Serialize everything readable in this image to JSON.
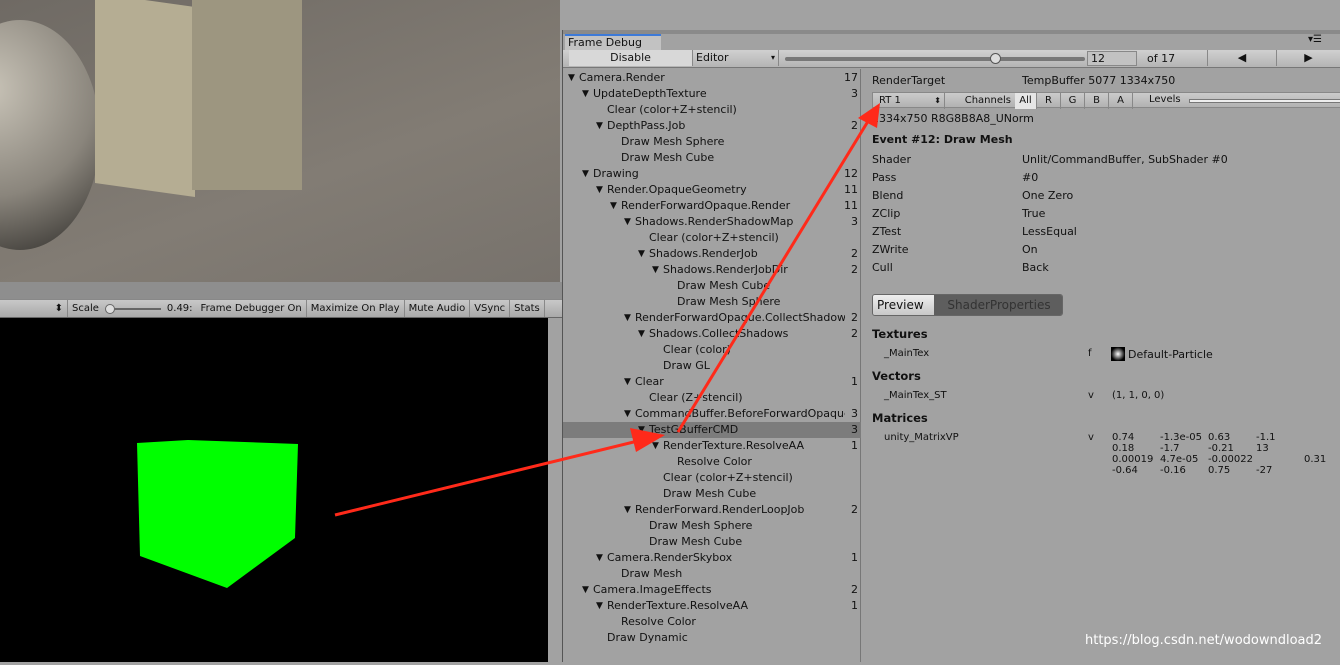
{
  "game_toolbar": {
    "scale_label": "Scale",
    "scale_value": "0.49:",
    "items": [
      "Frame Debugger On",
      "Maximize On Play",
      "Mute Audio",
      "VSync",
      "Stats"
    ]
  },
  "frame_debug": {
    "tab": "Frame Debug",
    "disable": "Disable",
    "target": "Editor",
    "event_index": "12",
    "event_total": "of 17",
    "event_fraction": 0.7,
    "tree": [
      {
        "l": 0,
        "t": "Camera.Render",
        "c": "17",
        "e": true
      },
      {
        "l": 1,
        "t": "UpdateDepthTexture",
        "c": "3",
        "e": true
      },
      {
        "l": 2,
        "t": "Clear (color+Z+stencil)"
      },
      {
        "l": 2,
        "t": "DepthPass.Job",
        "c": "2",
        "e": true
      },
      {
        "l": 3,
        "t": "Draw Mesh Sphere"
      },
      {
        "l": 3,
        "t": "Draw Mesh Cube"
      },
      {
        "l": 1,
        "t": "Drawing",
        "c": "12",
        "e": true
      },
      {
        "l": 2,
        "t": "Render.OpaqueGeometry",
        "c": "11",
        "e": true
      },
      {
        "l": 3,
        "t": "RenderForwardOpaque.Render",
        "c": "11",
        "e": true
      },
      {
        "l": 4,
        "t": "Shadows.RenderShadowMap",
        "c": "3",
        "e": true
      },
      {
        "l": 5,
        "t": "Clear (color+Z+stencil)"
      },
      {
        "l": 5,
        "t": "Shadows.RenderJob",
        "c": "2",
        "e": true
      },
      {
        "l": 6,
        "t": "Shadows.RenderJobDir",
        "c": "2",
        "e": true
      },
      {
        "l": 7,
        "t": "Draw Mesh Cube"
      },
      {
        "l": 7,
        "t": "Draw Mesh Sphere"
      },
      {
        "l": 4,
        "t": "RenderForwardOpaque.CollectShadows",
        "c": "2",
        "e": true
      },
      {
        "l": 5,
        "t": "Shadows.CollectShadows",
        "c": "2",
        "e": true
      },
      {
        "l": 6,
        "t": "Clear (color)"
      },
      {
        "l": 6,
        "t": "Draw GL"
      },
      {
        "l": 4,
        "t": "Clear",
        "c": "1",
        "e": true
      },
      {
        "l": 5,
        "t": "Clear (Z+stencil)"
      },
      {
        "l": 4,
        "t": "CommandBuffer.BeforeForwardOpaque",
        "c": "3",
        "e": true
      },
      {
        "l": 5,
        "t": "TestGBufferCMD",
        "c": "3",
        "e": true,
        "sel": true
      },
      {
        "l": 6,
        "t": "RenderTexture.ResolveAA",
        "c": "1",
        "e": true
      },
      {
        "l": 7,
        "t": "Resolve Color"
      },
      {
        "l": 6,
        "t": "Clear (color+Z+stencil)"
      },
      {
        "l": 6,
        "t": "Draw Mesh Cube"
      },
      {
        "l": 4,
        "t": "RenderForward.RenderLoopJob",
        "c": "2",
        "e": true
      },
      {
        "l": 5,
        "t": "Draw Mesh Sphere"
      },
      {
        "l": 5,
        "t": "Draw Mesh Cube"
      },
      {
        "l": 2,
        "t": "Camera.RenderSkybox",
        "c": "1",
        "e": true
      },
      {
        "l": 3,
        "t": "Draw Mesh"
      },
      {
        "l": 1,
        "t": "Camera.ImageEffects",
        "c": "2",
        "e": true
      },
      {
        "l": 2,
        "t": "RenderTexture.ResolveAA",
        "c": "1",
        "e": true
      },
      {
        "l": 3,
        "t": "Resolve Color"
      },
      {
        "l": 2,
        "t": "Draw Dynamic"
      }
    ],
    "detail": {
      "rt_label": "RenderTarget",
      "rt_value": "TempBuffer 5077 1334x750",
      "rt_select": "RT 1",
      "channels": "Channels",
      "channel_buttons": [
        "All",
        "R",
        "G",
        "B",
        "A"
      ],
      "levels": "Levels",
      "format": "1334x750 R8G8B8A8_UNorm",
      "event_title": "Event #12: Draw Mesh",
      "props": [
        [
          "Shader",
          "Unlit/CommandBuffer, SubShader #0"
        ],
        [
          "Pass",
          "#0"
        ],
        [
          "Blend",
          "One Zero"
        ],
        [
          "ZClip",
          "True"
        ],
        [
          "ZTest",
          "LessEqual"
        ],
        [
          "ZWrite",
          "On"
        ],
        [
          "Cull",
          "Back"
        ]
      ],
      "tabs": [
        "Preview",
        "ShaderProperties"
      ],
      "textures_h": "Textures",
      "tex_name": "_MainTex",
      "tex_type": "f",
      "tex_value": "Default-Particle",
      "vectors_h": "Vectors",
      "vec_name": "_MainTex_ST",
      "vec_type": "v",
      "vec_value": "(1, 1, 0, 0)",
      "matrices_h": "Matrices",
      "mat_name": "unity_MatrixVP",
      "mat_type": "v",
      "matrix": [
        [
          "0.74",
          "-1.3e-05",
          "0.63",
          "-1.1"
        ],
        [
          "0.18",
          "-1.7",
          "-0.21",
          "13"
        ],
        [
          "0.00019",
          "4.7e-05",
          "-0.00022",
          "0.31"
        ],
        [
          "-0.64",
          "-0.16",
          "0.75",
          "-27"
        ]
      ]
    }
  },
  "watermark": "https://blog.csdn.net/wodowndload2",
  "colors": {
    "accent": "#3d7ad8",
    "cube": "#00ff00",
    "arrow": "#ff2a1a"
  }
}
